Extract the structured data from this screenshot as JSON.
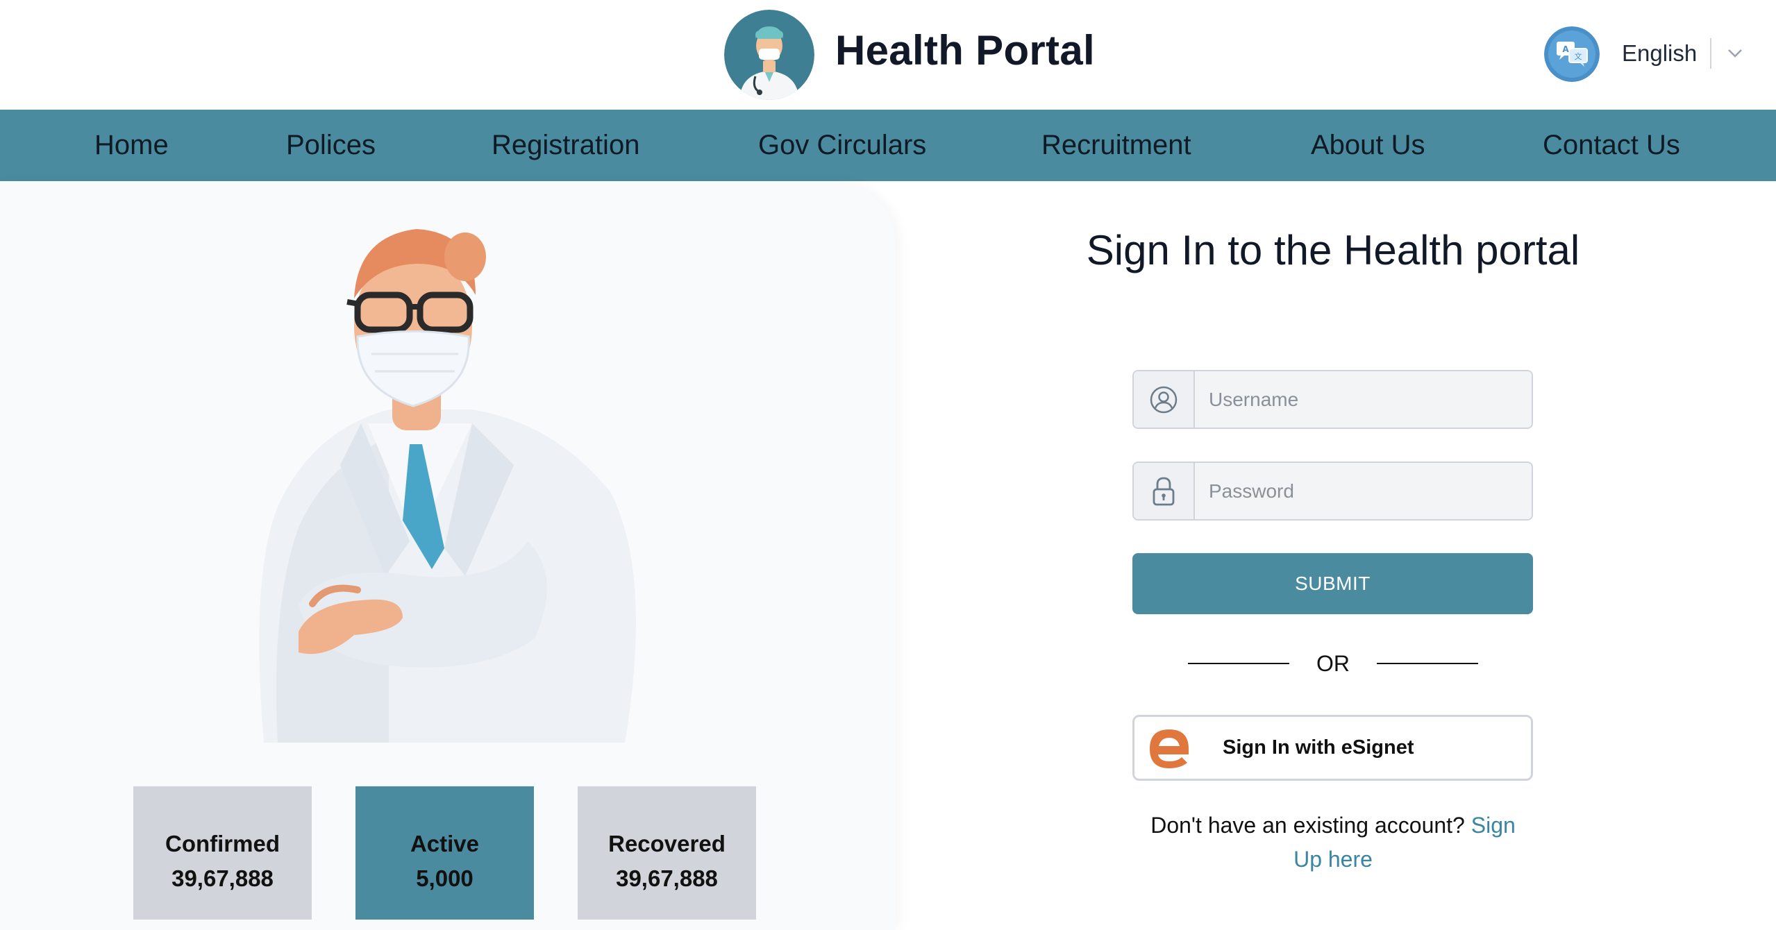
{
  "header": {
    "brand": "Health Portal",
    "logo_icon": "doctor-avatar-icon",
    "language": {
      "icon": "translate-icon",
      "selected": "English"
    }
  },
  "nav": {
    "items": [
      "Home",
      "Polices",
      "Registration",
      "Gov Circulars",
      "Recruitment",
      "About Us",
      "Contact Us"
    ]
  },
  "stats": [
    {
      "label": "Confirmed",
      "value": "39,67,888"
    },
    {
      "label": "Active",
      "value": "5,000"
    },
    {
      "label": "Recovered",
      "value": "39,67,888"
    }
  ],
  "signin": {
    "title": "Sign In to the Health portal",
    "username_placeholder": "Username",
    "password_placeholder": "Password",
    "submit_label": "SUBMIT",
    "or_text": "OR",
    "esignet_label": "Sign In with eSignet",
    "signup_prompt": "Don't have an existing account? ",
    "signup_link": "Sign Up here"
  },
  "colors": {
    "accent": "#4b8b9f",
    "link": "#3a86a0",
    "stat_neutral": "#d1d5db",
    "esignet_orange": "#e0773c"
  }
}
